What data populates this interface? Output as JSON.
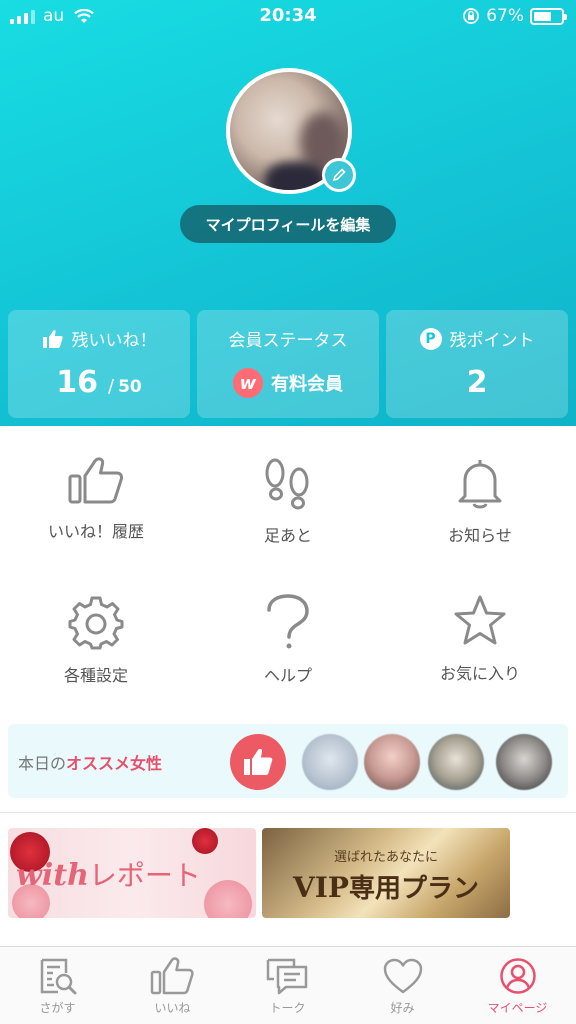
{
  "status_bar": {
    "carrier": "au",
    "time": "20:34",
    "battery": "67%",
    "battery_level": 0.67
  },
  "profile": {
    "edit_label": "マイプロフィールを編集"
  },
  "stats": {
    "likes": {
      "label": "残いいね！",
      "value": "16",
      "total": "50",
      "separator": "/"
    },
    "membership": {
      "label": "会員ステータス",
      "value": "有料会員",
      "logo": "w"
    },
    "points": {
      "label": "残ポイント",
      "value": "2",
      "icon_letter": "P"
    }
  },
  "menu": [
    {
      "label": "いいね！履歴",
      "icon": "thumbs-up-icon"
    },
    {
      "label": "足あと",
      "icon": "footprints-icon"
    },
    {
      "label": "お知らせ",
      "icon": "bell-icon"
    },
    {
      "label": "各種設定",
      "icon": "gear-icon"
    },
    {
      "label": "ヘルプ",
      "icon": "question-icon"
    },
    {
      "label": "お気に入り",
      "icon": "star-icon"
    }
  ],
  "recommend": {
    "prefix": "本日の",
    "highlight": "オススメ女性"
  },
  "banners": {
    "with_report": {
      "brand": "with",
      "text": "レポート"
    },
    "vip": {
      "small": "選ばれたあなたに",
      "big_latin": "VIP",
      "big_jp": "専用プラン"
    }
  },
  "tabbar": [
    {
      "label": "さがす",
      "icon": "search-icon"
    },
    {
      "label": "いいね",
      "icon": "thumbs-up-icon"
    },
    {
      "label": "トーク",
      "icon": "chat-icon"
    },
    {
      "label": "好み",
      "icon": "heart-icon"
    },
    {
      "label": "マイページ",
      "icon": "profile-icon",
      "active": true
    }
  ],
  "colors": {
    "accent": "#17c8d8",
    "pink": "#e8506c",
    "icon_gray": "#8a8a8a"
  }
}
